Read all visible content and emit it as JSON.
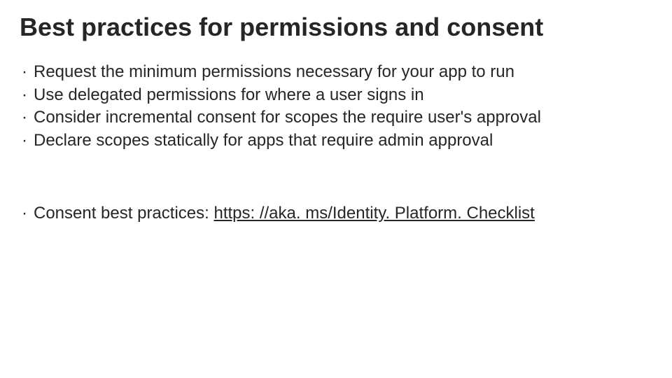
{
  "title": "Best practices for permissions and consent",
  "bullets": [
    "Request the minimum permissions necessary for your app to run",
    "Use delegated permissions for where a user signs in",
    "Consider incremental consent for scopes the require user's approval",
    "Declare scopes statically for apps that require admin approval"
  ],
  "footer": {
    "prefix": "Consent best practices: ",
    "link_text": "https: //aka. ms/Identity. Platform. Checklist"
  }
}
